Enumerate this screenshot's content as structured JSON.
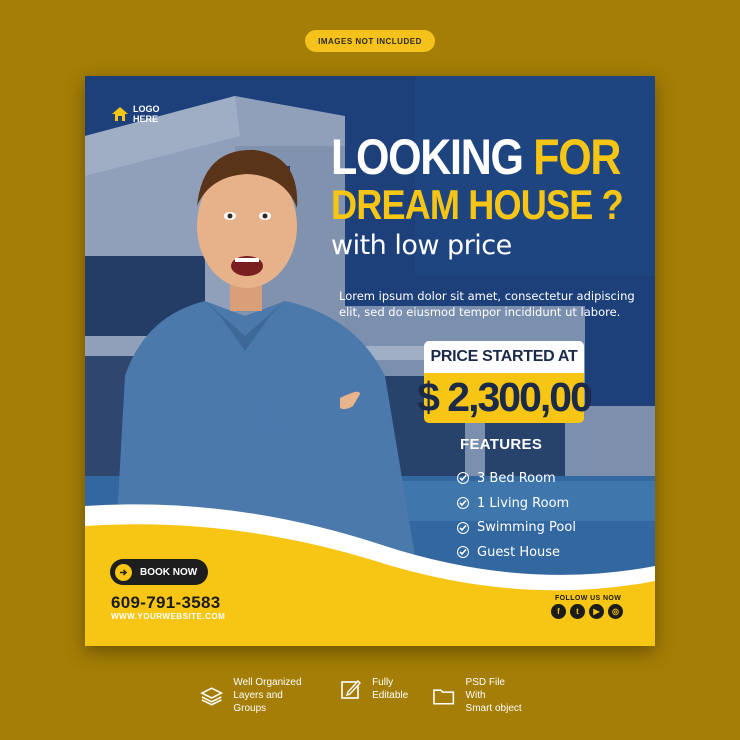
{
  "badge": "IMAGES NOT INCLUDED",
  "logo": {
    "line1": "LOGO",
    "line2": "HERE",
    "icon": "house-icon"
  },
  "headline": {
    "looking": "LOOKING",
    "for": "FOR",
    "dream": "DREAM HOUSE ?",
    "sub": "with low price"
  },
  "lorem": "Lorem ipsum dolor sit amet, consectetur adipiscing elit, sed do eiusmod tempor incididunt ut labore.",
  "price": {
    "label": "PRICE STARTED AT",
    "value": "$ 2,300,00"
  },
  "features": {
    "title": "FEATURES",
    "items": [
      "3 Bed Room",
      "1 Living Room",
      "Swimming Pool",
      "Guest House"
    ]
  },
  "cta": {
    "book": "BOOK NOW",
    "phone": "609-791-3583",
    "website": "WWW.YOURWEBSITE.COM"
  },
  "follow": {
    "label": "FOLLOW US NOW",
    "icons": [
      "facebook-icon",
      "twitter-icon",
      "youtube-icon",
      "instagram-icon"
    ]
  },
  "bottom": [
    {
      "icon": "layers-icon",
      "text": "Well Organized\nLayers and Groups"
    },
    {
      "icon": "edit-icon",
      "text": "Fully\nEditable"
    },
    {
      "icon": "folder-icon",
      "text": "PSD File With\nSmart object"
    }
  ],
  "colors": {
    "background": "#a47e06",
    "accent": "#f7c514",
    "navy": "#1d3f79"
  }
}
